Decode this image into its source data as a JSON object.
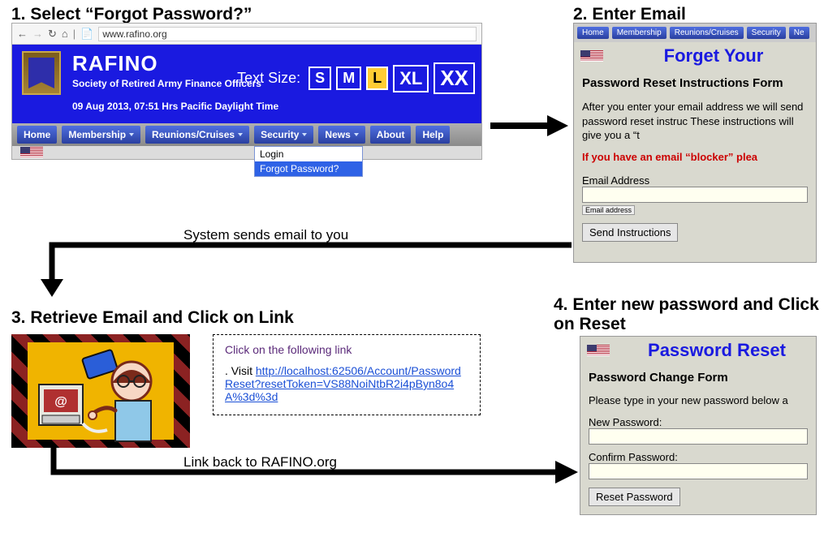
{
  "step1": {
    "header": "1.  Select “Forgot Password?”",
    "url": "www.rafino.org",
    "brand": "RAFINO",
    "subtitle": "Society of Retired Army Finance Officers",
    "datetime": "09 Aug 2013, 07:51 Hrs Pacific Daylight Time",
    "textsize_label": "Text Size:",
    "sizes": {
      "s": "S",
      "m": "M",
      "l": "L",
      "xl": "XL",
      "xx": "XX"
    },
    "nav": {
      "home": "Home",
      "membership": "Membership",
      "reunions": "Reunions/Cruises",
      "security": "Security",
      "news": "News",
      "about": "About",
      "help": "Help"
    },
    "dropdown": {
      "login": "Login",
      "forgot": "Forgot Password?"
    }
  },
  "step2": {
    "header": "2.  Enter Email",
    "pills": {
      "home": "Home",
      "membership": "Membership",
      "reunions": "Reunions/Cruises",
      "security": "Security",
      "ne": "Ne"
    },
    "title": "Forget Your",
    "section": "Password Reset Instructions Form",
    "para": "After you enter your email address we will send password reset instruc These instructions will give you a “t",
    "warn": "If you have an email “blocker” plea",
    "email_label": "Email Address",
    "tiny": "Email address",
    "submit": "Send Instructions"
  },
  "caption_email": "System sends email to you",
  "step3": {
    "header": "3.  Retrieve Email and Click on Link",
    "link_title": "Click on the following link",
    "dot_visit": ". Visit ",
    "url": "http://localhost:62506/Account/PasswordReset?resetToken=VS88NoiNtbR2i4pByn8o4A%3d%3d"
  },
  "caption_linkback": "Link back to RAFINO.org",
  "step4": {
    "header": "4.  Enter new password and Click on Reset",
    "title": "Password Reset",
    "section": "Password Change Form",
    "para": "Please type in your new password below a",
    "new_label": "New Password:",
    "confirm_label": "Confirm Password:",
    "submit": "Reset Password"
  }
}
